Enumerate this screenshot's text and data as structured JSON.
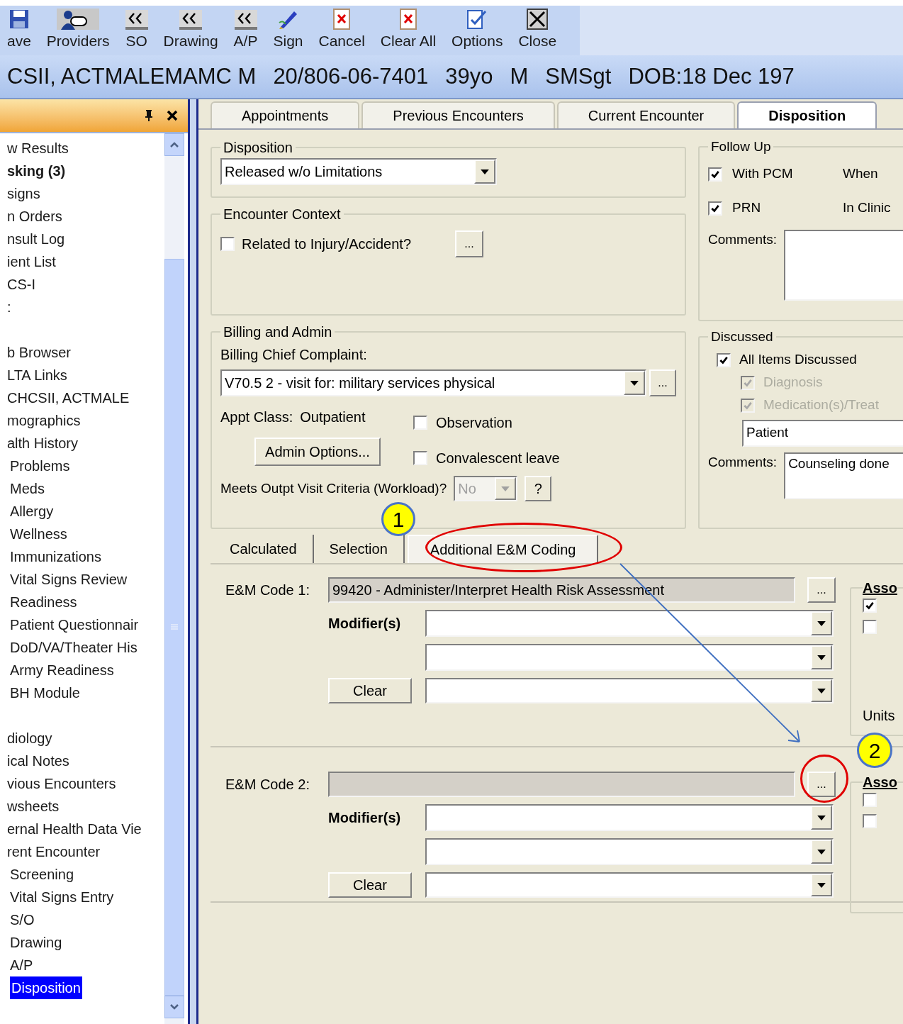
{
  "toolbar": {
    "buttons": [
      {
        "label": "ave",
        "kind": "save"
      },
      {
        "label": "Providers",
        "kind": "providers"
      },
      {
        "label": "SO",
        "kind": "back"
      },
      {
        "label": "Drawing",
        "kind": "back"
      },
      {
        "label": "A/P",
        "kind": "back"
      },
      {
        "label": "Sign",
        "kind": "sign"
      },
      {
        "label": "Cancel",
        "kind": "cancel"
      },
      {
        "label": "Clear All",
        "kind": "cancel"
      },
      {
        "label": "Options",
        "kind": "options"
      },
      {
        "label": "Close",
        "kind": "close"
      }
    ]
  },
  "patient_banner": {
    "fields": [
      "CSII, ACTMALEMAMC M",
      "20/806-06-7401",
      "39yo",
      "M",
      "SMSgt",
      "DOB:18 Dec 197"
    ]
  },
  "sidebar": {
    "sections": [
      {
        "items": [
          {
            "label": "w Results",
            "bold": false,
            "selected": false
          },
          {
            "label": "sking (3)",
            "bold": true,
            "selected": false
          },
          {
            "label": "signs",
            "bold": false,
            "selected": false
          },
          {
            "label": "n Orders",
            "bold": false,
            "selected": false
          },
          {
            "label": "nsult Log",
            "bold": false,
            "selected": false
          },
          {
            "label": "ient List",
            "bold": false,
            "selected": false
          },
          {
            "label": "CS-I",
            "bold": false,
            "selected": false
          },
          {
            "label": ":",
            "bold": false,
            "selected": false
          }
        ]
      },
      {
        "items": [
          {
            "label": "b Browser",
            "bold": false,
            "selected": false
          },
          {
            "label": "LTA Links",
            "bold": false,
            "selected": false
          },
          {
            "label": "CHCSII, ACTMALE",
            "bold": false,
            "selected": false
          },
          {
            "label": "mographics",
            "bold": false,
            "selected": false
          },
          {
            "label": "alth History",
            "bold": false,
            "selected": false,
            "children": [
              {
                "label": "Problems",
                "bold": false,
                "selected": false
              },
              {
                "label": "Meds",
                "bold": false,
                "selected": false
              },
              {
                "label": "Allergy",
                "bold": false,
                "selected": false
              },
              {
                "label": "Wellness",
                "bold": false,
                "selected": false
              },
              {
                "label": "Immunizations",
                "bold": false,
                "selected": false
              },
              {
                "label": "Vital Signs Review",
                "bold": false,
                "selected": false
              },
              {
                "label": "Readiness",
                "bold": false,
                "selected": false
              },
              {
                "label": "Patient Questionnair",
                "bold": false,
                "selected": false
              },
              {
                "label": "DoD/VA/Theater His",
                "bold": false,
                "selected": false
              },
              {
                "label": "Army Readiness",
                "bold": false,
                "selected": false
              },
              {
                "label": "BH Module",
                "bold": false,
                "selected": false
              }
            ]
          }
        ]
      },
      {
        "items": [
          {
            "label": "diology",
            "bold": false,
            "selected": false
          },
          {
            "label": "ical Notes",
            "bold": false,
            "selected": false
          },
          {
            "label": "vious Encounters",
            "bold": false,
            "selected": false
          },
          {
            "label": "wsheets",
            "bold": false,
            "selected": false
          },
          {
            "label": "ernal Health Data Vie",
            "bold": false,
            "selected": false
          },
          {
            "label": "rent Encounter",
            "bold": false,
            "selected": false,
            "children": [
              {
                "label": "Screening",
                "bold": false,
                "selected": false
              },
              {
                "label": "Vital Signs Entry",
                "bold": false,
                "selected": false
              },
              {
                "label": "S/O",
                "bold": false,
                "selected": false
              },
              {
                "label": "Drawing",
                "bold": false,
                "selected": false
              },
              {
                "label": "A/P",
                "bold": false,
                "selected": false
              },
              {
                "label": "Disposition",
                "bold": false,
                "selected": true
              }
            ]
          }
        ]
      }
    ]
  },
  "tabs": [
    {
      "label": "Appointments",
      "selected": false
    },
    {
      "label": "Previous Encounters",
      "selected": false
    },
    {
      "label": "Current Encounter",
      "selected": false
    },
    {
      "label": "Disposition",
      "selected": true
    }
  ],
  "disposition": {
    "title": "Disposition",
    "value": "Released w/o Limitations"
  },
  "encounter_context": {
    "title": "Encounter Context",
    "checkbox": {
      "label": "Related to Injury/Accident?",
      "checked": false
    },
    "more_button": "..."
  },
  "billing": {
    "title": "Billing and Admin",
    "complaint_label": "Billing Chief Complaint:",
    "complaint_value": "V70.5 2 - visit for: military services physical",
    "more_button": "...",
    "appt_class_label": "Appt Class:",
    "appt_class_value": "Outpatient",
    "admin_button": "Admin Options...",
    "options": [
      {
        "label": "Observation",
        "checked": false
      },
      {
        "label": "Convalescent leave",
        "checked": false
      }
    ],
    "criteria_label": "Meets Outpt Visit Criteria (Workload)?",
    "criteria_value": "No",
    "criteria_disabled": true,
    "help_button": "?"
  },
  "follow_up": {
    "title": "Follow Up",
    "items": [
      {
        "label": "With PCM",
        "checked": true,
        "note": "When"
      },
      {
        "label": "PRN",
        "checked": true,
        "note": "In Clinic"
      }
    ],
    "comments_label": "Comments:"
  },
  "discussed": {
    "title": "Discussed",
    "items": [
      {
        "label": "All Items Discussed",
        "checked": true,
        "disabled": false
      },
      {
        "label": "Diagnosis",
        "checked": true,
        "disabled": true
      },
      {
        "label": "Medication(s)/Treat",
        "checked": true,
        "disabled": true
      }
    ],
    "who": "Patient",
    "comments_label": "Comments:",
    "comments": "Counseling done"
  },
  "em_tabs": [
    {
      "label": "Calculated",
      "selected": false
    },
    {
      "label": "Selection",
      "selected": false
    },
    {
      "label": "Additional E&M Coding",
      "selected": true
    }
  ],
  "em_codes": [
    {
      "label": "E&M Code 1:",
      "value": "99420 - Administer/Interpret Health Risk Assessment",
      "more_button": "...",
      "modifier_label": "Modifier(s)",
      "clear_button": "Clear",
      "assoc_title": "Asso",
      "assoc_checks": [
        {
          "checked": true
        },
        {
          "checked": false
        }
      ],
      "units_label": "Units"
    },
    {
      "label": "E&M Code 2:",
      "more_button": "...",
      "modifier_label": "Modifier(s)",
      "clear_button": "Clear",
      "assoc_title": "Asso",
      "assoc_checks": [
        {
          "checked": false
        },
        {
          "checked": false
        }
      ]
    }
  ],
  "annotations": [
    {
      "label": "1"
    },
    {
      "label": "2"
    }
  ]
}
